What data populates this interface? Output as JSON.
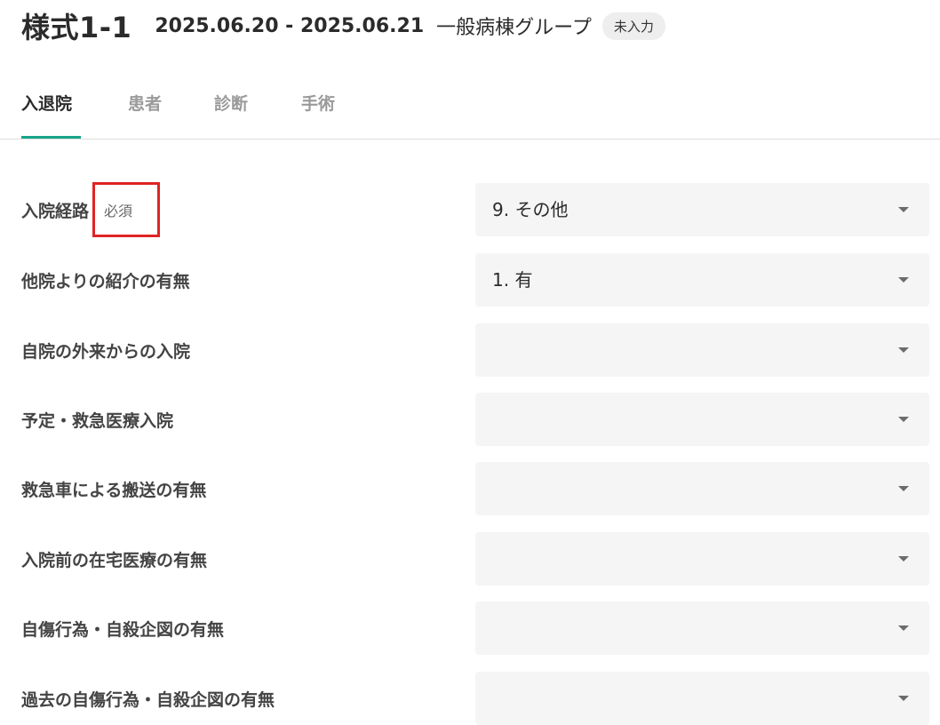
{
  "header": {
    "form_title": "様式1-1",
    "date_range": "2025.06.20 - 2025.06.21",
    "ward_group": "一般病棟グループ",
    "status": "未入力"
  },
  "tabs": [
    {
      "label": "入退院",
      "active": true
    },
    {
      "label": "患者",
      "active": false
    },
    {
      "label": "診断",
      "active": false
    },
    {
      "label": "手術",
      "active": false
    }
  ],
  "fields": [
    {
      "label": "入院経路",
      "required_label": "必須",
      "value": "9. その他"
    },
    {
      "label": "他院よりの紹介の有無",
      "value": "1. 有"
    },
    {
      "label": "自院の外来からの入院",
      "value": ""
    },
    {
      "label": "予定・救急医療入院",
      "value": ""
    },
    {
      "label": "救急車による搬送の有無",
      "value": ""
    },
    {
      "label": "入院前の在宅医療の有無",
      "value": ""
    },
    {
      "label": "自傷行為・自殺企図の有無",
      "value": ""
    },
    {
      "label": "過去の自傷行為・自殺企図の有無",
      "value": ""
    }
  ],
  "colors": {
    "tab_active_underline": "#1aa58a",
    "highlight_box": "#e02424",
    "select_background": "#f5f5f5"
  }
}
